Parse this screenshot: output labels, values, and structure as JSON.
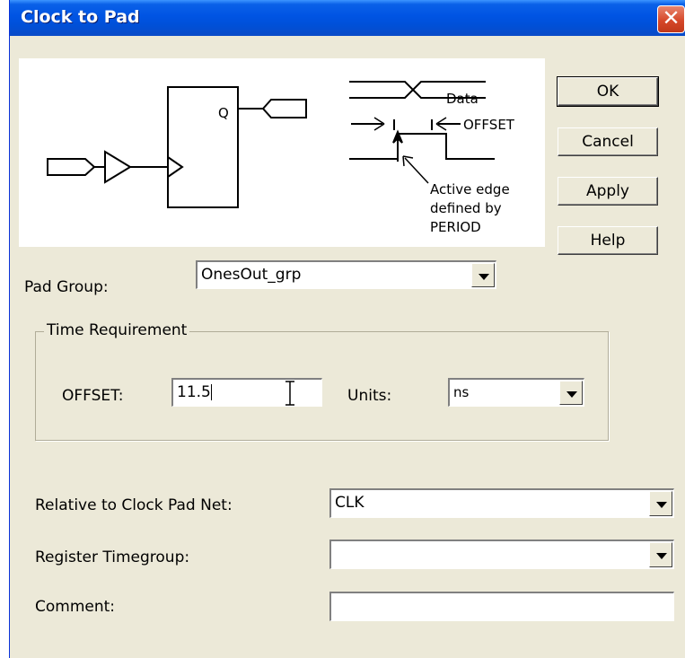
{
  "window": {
    "title": "Clock to Pad",
    "close_symbol": "✕"
  },
  "diagram": {
    "q_label": "Q",
    "data_label": "Data",
    "offset_label": "OFFSET",
    "active_edge_line1": "Active edge",
    "active_edge_line2": "defined by",
    "active_edge_line3": "PERIOD"
  },
  "buttons": {
    "ok": "OK",
    "cancel": "Cancel",
    "apply": "Apply",
    "help": "Help"
  },
  "pad_group": {
    "label": "Pad Group:",
    "value": "OnesOut_grp"
  },
  "time_requirement": {
    "group_label": "Time Requirement",
    "offset_label": "OFFSET:",
    "offset_value": "11.5",
    "units_label": "Units:",
    "units_value": "ns"
  },
  "relative_clock": {
    "label": "Relative to Clock Pad Net:",
    "value": "CLK"
  },
  "register_timegroup": {
    "label": "Register Timegroup:",
    "value": ""
  },
  "comment": {
    "label": "Comment:",
    "value": ""
  }
}
